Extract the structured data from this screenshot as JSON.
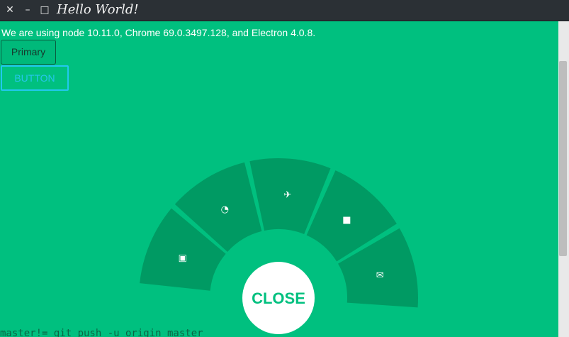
{
  "window": {
    "title": "Hello World!",
    "controls": {
      "close": "✕",
      "minimize": "–",
      "maximize": "□"
    }
  },
  "main": {
    "info_text": "We are using node 10.11.0, Chrome 69.0.3497.128, and Electron 4.0.8.",
    "primary_button": "Primary",
    "outline_button": "BUTTON"
  },
  "radial_menu": {
    "items": [
      {
        "icon": "image-icon",
        "glyph": "▣"
      },
      {
        "icon": "refresh-icon",
        "glyph": "◔"
      },
      {
        "icon": "run-icon",
        "glyph": "✈"
      },
      {
        "icon": "video-icon",
        "glyph": "■"
      },
      {
        "icon": "mail-icon",
        "glyph": "✉"
      }
    ],
    "close_label": "CLOSE"
  },
  "background_terminal_text": "master!=  git push -u origin master"
}
